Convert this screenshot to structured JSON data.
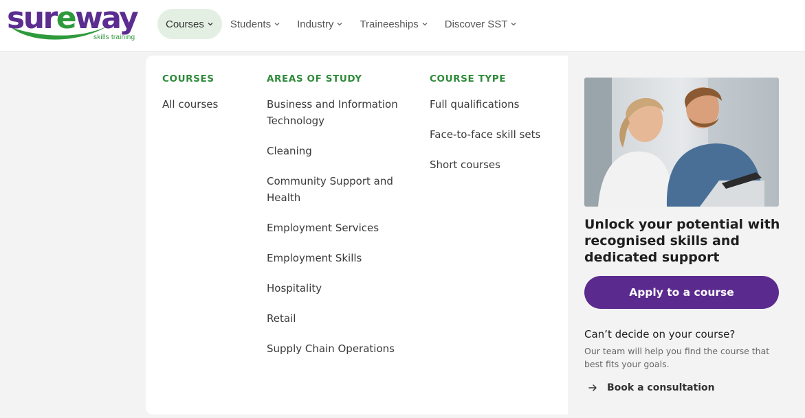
{
  "brand": {
    "logo_prefix": "sur",
    "logo_accent": "e",
    "logo_suffix": "way",
    "tagline": "skills training",
    "purple": "#5b2d91",
    "green": "#2e9a3c"
  },
  "nav": {
    "items": [
      {
        "label": "Courses",
        "active": true
      },
      {
        "label": "Students",
        "active": false
      },
      {
        "label": "Industry",
        "active": false
      },
      {
        "label": "Traineeships",
        "active": false
      },
      {
        "label": "Discover SST",
        "active": false
      }
    ],
    "chevron_icon": "chevron-down-icon"
  },
  "menu": {
    "courses": {
      "heading": "COURSES",
      "links": [
        "All courses"
      ]
    },
    "areas": {
      "heading": "AREAS OF STUDY",
      "links": [
        "Business and Information Technology",
        "Cleaning",
        "Community Support and Health",
        "Employment Services",
        "Employment Skills",
        "Hospitality",
        "Retail",
        "Supply Chain Operations"
      ]
    },
    "types": {
      "heading": "COURSE TYPE",
      "links": [
        "Full qualifications",
        "Face-to-face skill sets",
        "Short courses"
      ]
    }
  },
  "promo": {
    "image_icon": "photo-two-people-laptop",
    "title": "Unlock your potential with recognised skills and dedicated support",
    "apply_label": "Apply to a course",
    "question": "Can’t decide on your course?",
    "description": "Our team will help you find the course that best fits your goals.",
    "consult_icon": "arrow-right-icon",
    "consult_label": "Book a consultation"
  }
}
